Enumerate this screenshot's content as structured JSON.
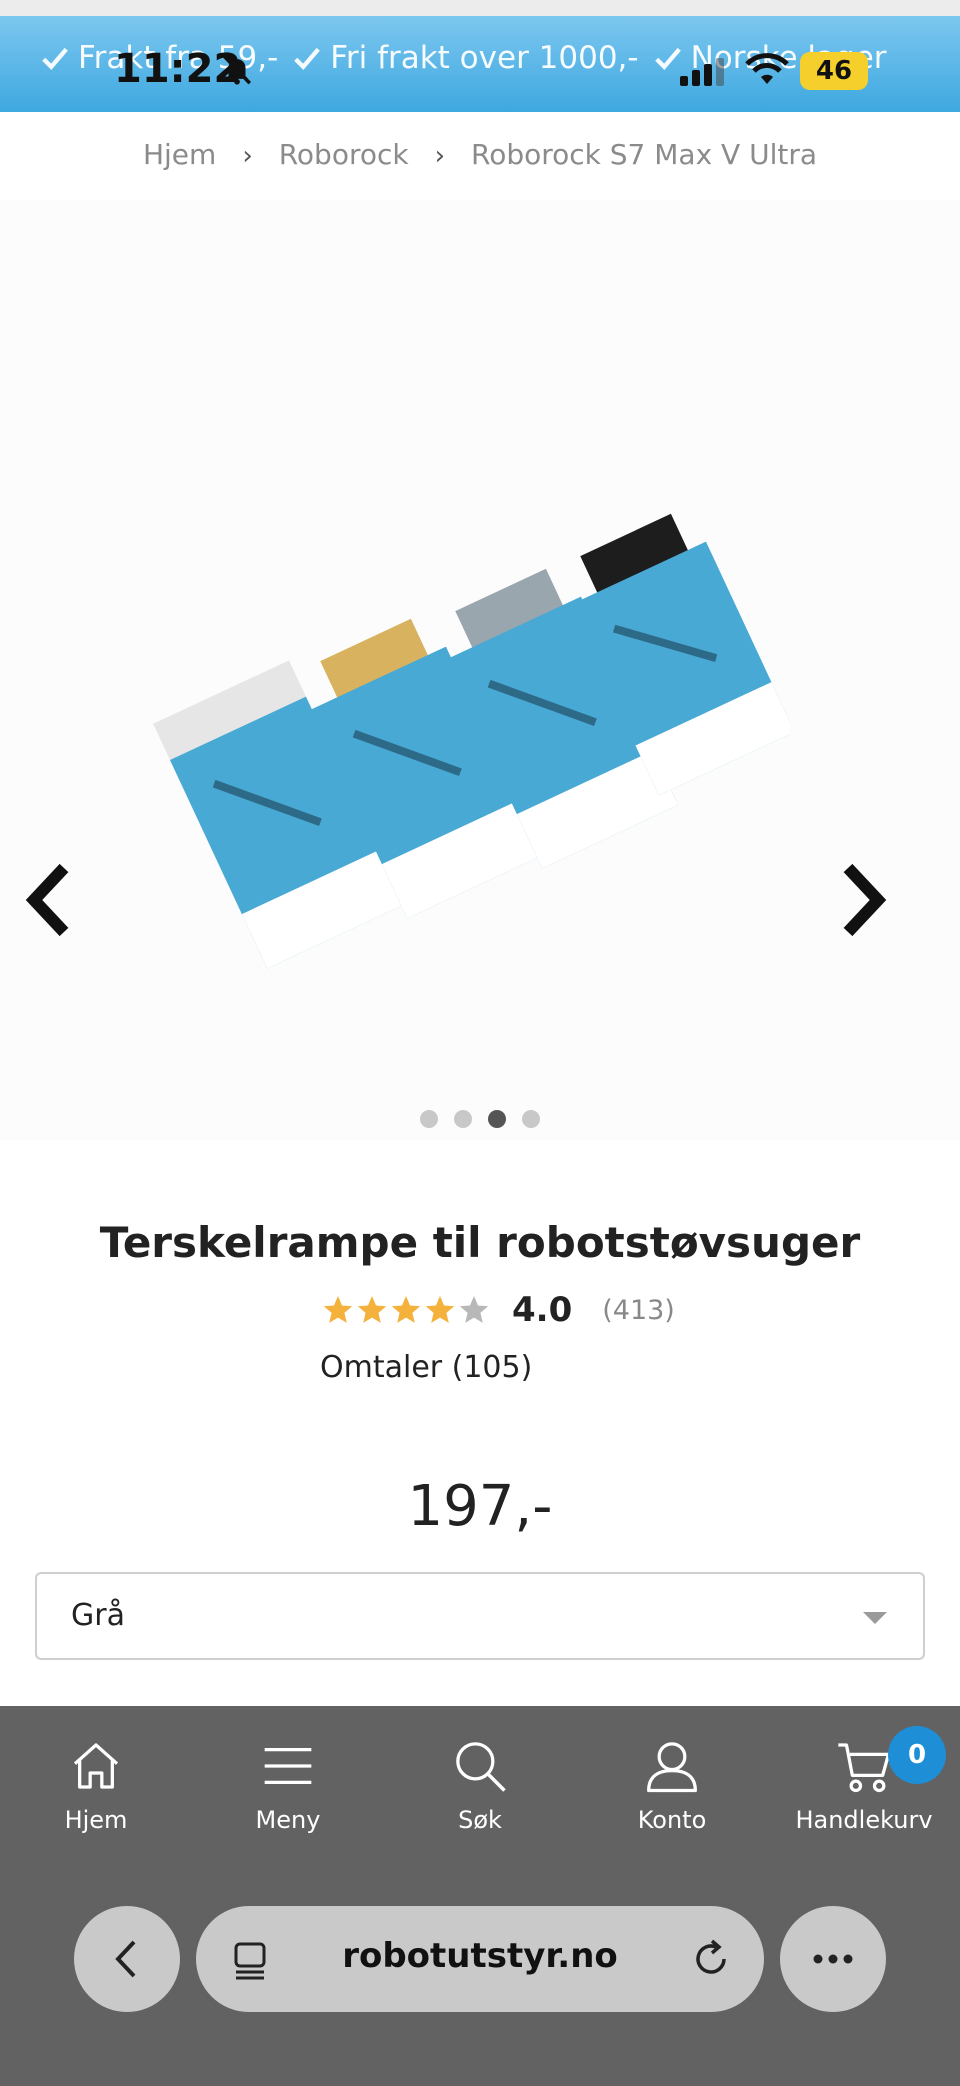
{
  "status_bar": {
    "time": "11:22",
    "battery": "46"
  },
  "banner": {
    "messages": [
      "Frakt fra 59,-",
      "Fri frakt over 1000,-",
      "Norske lager"
    ]
  },
  "breadcrumb": [
    "Hjem",
    "Roborock",
    "Roborock S7 Max V Ultra"
  ],
  "gallery": {
    "image_count": 4,
    "active_index": 2
  },
  "product": {
    "title": "Terskelrampe til robotstøvsuger",
    "rating": {
      "stars": 4,
      "max_stars": 5,
      "value": "4.0",
      "count": "(413)"
    },
    "reviews_link": "Omtaler (105)",
    "price": "197,-",
    "variant": {
      "selected": "Grå"
    }
  },
  "bottom_nav": {
    "items": [
      {
        "label": "Hjem",
        "icon": "home-icon"
      },
      {
        "label": "Meny",
        "icon": "menu-icon"
      },
      {
        "label": "Søk",
        "icon": "search-icon"
      },
      {
        "label": "Konto",
        "icon": "account-icon"
      },
      {
        "label": "Handlekurv",
        "icon": "cart-icon"
      }
    ],
    "cart_count": "0"
  },
  "browser": {
    "url": "robotutstyr.no"
  },
  "colors": {
    "banner": "#3ea8e0",
    "star": "#f4b13c",
    "nav_bg": "#626262",
    "cart_badge": "#1e8fd6"
  }
}
